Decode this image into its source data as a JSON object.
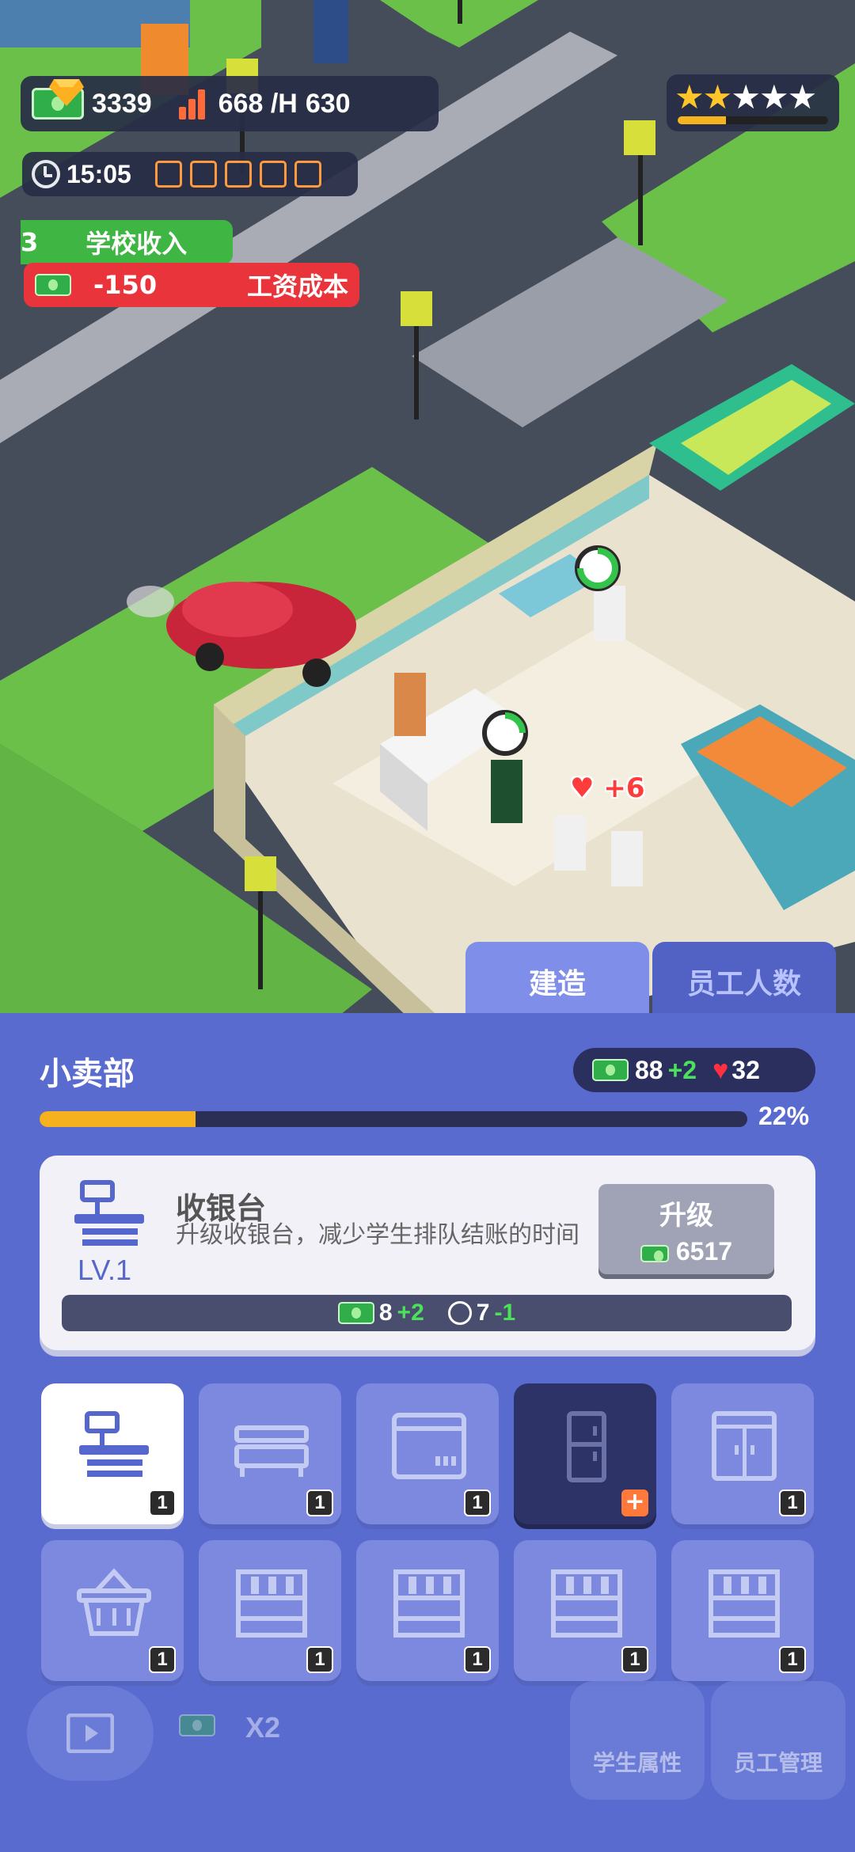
{
  "hud": {
    "cash": "3339",
    "income_rate": "668 /H",
    "gems": "630",
    "time": "15:05",
    "stars_filled": 2,
    "stars_total": 5,
    "star_progress": 0.32
  },
  "floating": {
    "income_prefix": "3",
    "income_label": "学校收入",
    "cost_value": "-150",
    "cost_label": "工资成本",
    "heart_bonus": "+6"
  },
  "tabs": {
    "build": "建造",
    "staff_count": "员工人数"
  },
  "shop": {
    "name": "小卖部",
    "income": "88",
    "income_bonus": "+2",
    "satisfaction": "32",
    "progress_pct": "22%",
    "progress": 0.22
  },
  "item": {
    "title": "收银台",
    "description": "升级收银台，减少学生排队结账的时间",
    "level": "LV.1",
    "upgrade_label": "升级",
    "upgrade_cost": "6517",
    "stat_income": "8",
    "stat_income_bonus": "+2",
    "stat_time": "7",
    "stat_time_delta": "-1"
  },
  "slots": [
    {
      "icon": "cashier-icon",
      "count": "1",
      "state": "selected"
    },
    {
      "icon": "shelf-icon",
      "count": "1",
      "state": "normal"
    },
    {
      "icon": "oven-icon",
      "count": "1",
      "state": "normal"
    },
    {
      "icon": "fridge-icon",
      "count": "+",
      "state": "locked"
    },
    {
      "icon": "cabinet-icon",
      "count": "1",
      "state": "normal"
    },
    {
      "icon": "basket-icon",
      "count": "1",
      "state": "normal"
    },
    {
      "icon": "rack-icon",
      "count": "1",
      "state": "normal"
    },
    {
      "icon": "rack-icon",
      "count": "1",
      "state": "normal"
    },
    {
      "icon": "rack-icon",
      "count": "1",
      "state": "normal"
    },
    {
      "icon": "rack-icon",
      "count": "1",
      "state": "normal"
    }
  ],
  "bottom_nav": {
    "x2_label": "X2",
    "student_attr": "学生属性",
    "staff_mgmt": "员工管理"
  },
  "colors": {
    "panel_bg": "#5a6bd0",
    "slot_bg": "#7c89de",
    "accent_yellow": "#f5b21e",
    "cash_green": "#2fae4a",
    "cost_red": "#e8343a"
  }
}
